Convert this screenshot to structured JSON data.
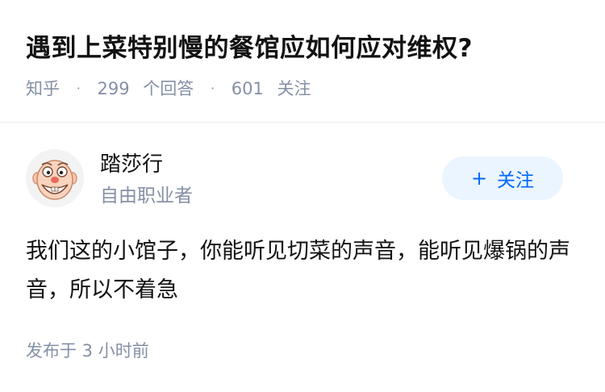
{
  "question": {
    "title": "遇到上菜特别慢的餐馆应如何应对维权?",
    "source": "知乎",
    "separator": "·",
    "answers_count": "299",
    "answers_label": "个回答",
    "followers_count": "601",
    "followers_label": "关注"
  },
  "answer": {
    "author": {
      "name": "踏莎行",
      "headline": "自由职业者",
      "avatar_icon": "cartoon-face-avatar"
    },
    "follow_button": {
      "icon": "plus-icon",
      "icon_glyph": "+",
      "label": "关注"
    },
    "content": "我们这的小馆子，你能听见切菜的声音，能听见爆锅的声音，所以不着急",
    "time": "发布于 3 小时前"
  },
  "colors": {
    "primary_text": "#121212",
    "secondary_text": "#8590a6",
    "brand_blue": "#0066ff",
    "button_bg": "#ebf5ff",
    "divider": "#ebebeb"
  }
}
